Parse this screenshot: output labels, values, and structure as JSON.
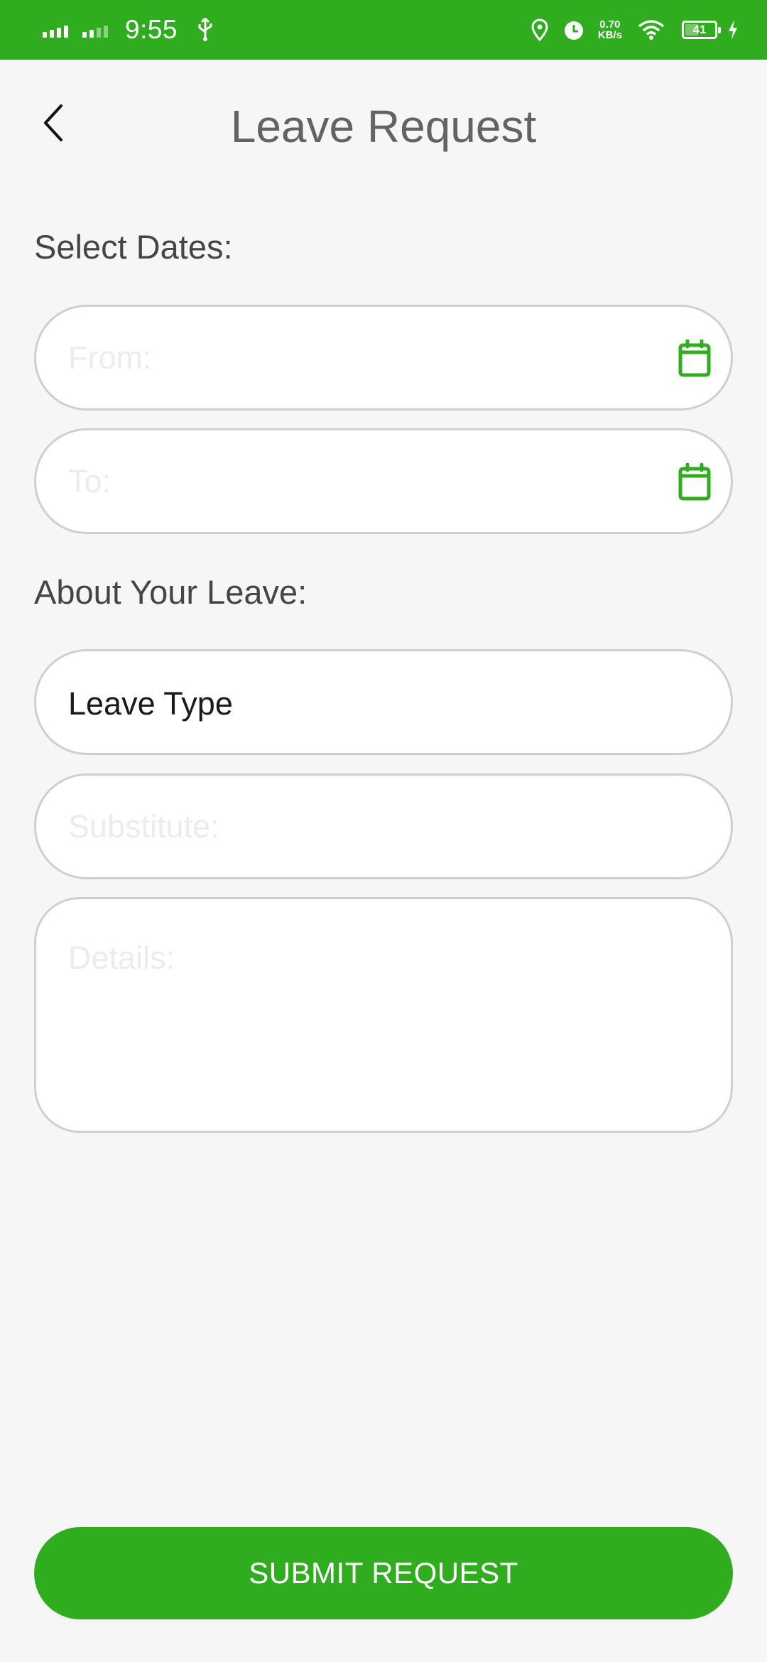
{
  "status_bar": {
    "time": "9:55",
    "net_speed_value": "0.70",
    "net_speed_unit": "KB/s",
    "battery_level": "41",
    "icons": [
      "signal-icon",
      "usb-icon",
      "location-icon",
      "alarm-icon",
      "wifi-icon",
      "battery-icon",
      "charging-icon"
    ]
  },
  "header": {
    "title": "Leave Request",
    "back_icon": "chevron-left-icon"
  },
  "dates_section": {
    "label": "Select Dates:",
    "from_placeholder": "From:",
    "to_placeholder": "To:",
    "calendar_icon": "calendar-icon"
  },
  "leave_section": {
    "label": "About Your Leave:",
    "leave_type_value": "Leave Type",
    "substitute_placeholder": "Substitute:",
    "details_placeholder": "Details:"
  },
  "actions": {
    "submit_label": "SUBMIT REQUEST"
  },
  "colors": {
    "accent": "#30ad1e",
    "background": "#f6f6f6",
    "field_border": "#cfcfcf",
    "title_text": "#636363",
    "label_text": "#454545",
    "placeholder_text": "#ecebef"
  }
}
